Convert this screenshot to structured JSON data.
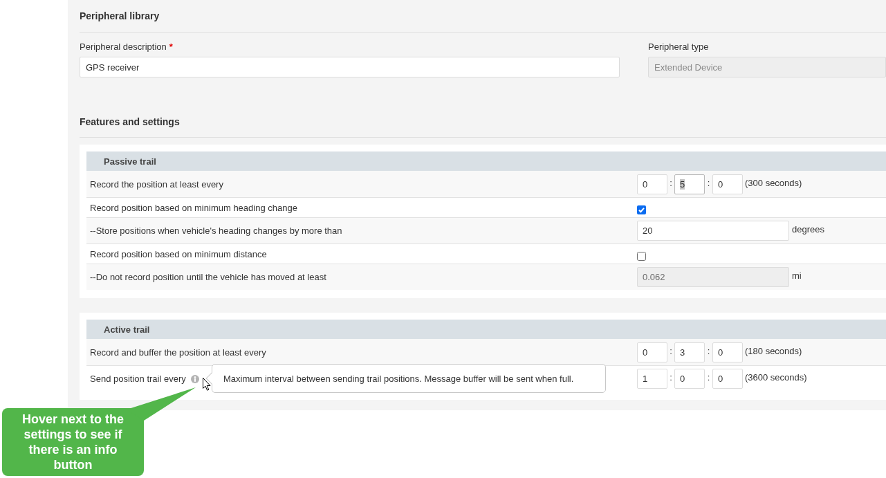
{
  "page": {
    "title": "Peripheral library"
  },
  "fields": [
    {
      "label": "Peripheral description",
      "required_mark": "*",
      "value": "GPS receiver",
      "disabled": false
    },
    {
      "label": "Peripheral type",
      "value": "Extended Device",
      "disabled": true
    }
  ],
  "features": {
    "title": "Features and settings"
  },
  "sections": [
    {
      "title": "Passive trail",
      "rows": [
        {
          "kind": "time",
          "label": "Record the position at least every",
          "parts": [
            {
              "value": "0",
              "highlighted": false
            },
            {
              "value": "5",
              "highlighted": true
            },
            {
              "value": "0",
              "highlighted": false
            }
          ],
          "separators": [
            ":",
            ":"
          ],
          "note": "(300 seconds)"
        },
        {
          "kind": "checkbox",
          "label": "Record position based on minimum heading change",
          "checked": true
        },
        {
          "kind": "number",
          "label": "--Store positions when vehicle's heading changes by more than",
          "value": "20",
          "unit": "degrees",
          "disabled": false
        },
        {
          "kind": "checkbox",
          "label": "Record position based on minimum distance",
          "checked": false
        },
        {
          "kind": "number",
          "label": "--Do not record position until the vehicle has moved at least",
          "value": "0.062",
          "unit": "mi",
          "disabled": true
        }
      ]
    },
    {
      "title": "Active trail",
      "rows": [
        {
          "kind": "time",
          "label": "Record and buffer the position at least every",
          "parts": [
            {
              "value": "0",
              "highlighted": false
            },
            {
              "value": "3",
              "highlighted": false
            },
            {
              "value": "0",
              "highlighted": false
            }
          ],
          "separators": [
            ":",
            ":"
          ],
          "note": "(180 seconds)"
        },
        {
          "kind": "time",
          "label": "Send position trail every",
          "tooltip": "Maximum interval between sending trail positions. Message buffer will be sent when full.",
          "parts": [
            {
              "value": "1",
              "highlighted": false
            },
            {
              "value": "0",
              "highlighted": false
            },
            {
              "value": "0",
              "highlighted": false
            }
          ],
          "separators": [
            ":",
            ":"
          ],
          "note": "(3600 seconds)"
        }
      ]
    }
  ],
  "callout": {
    "text": "Hover next to the settings to see if there is an info button"
  }
}
